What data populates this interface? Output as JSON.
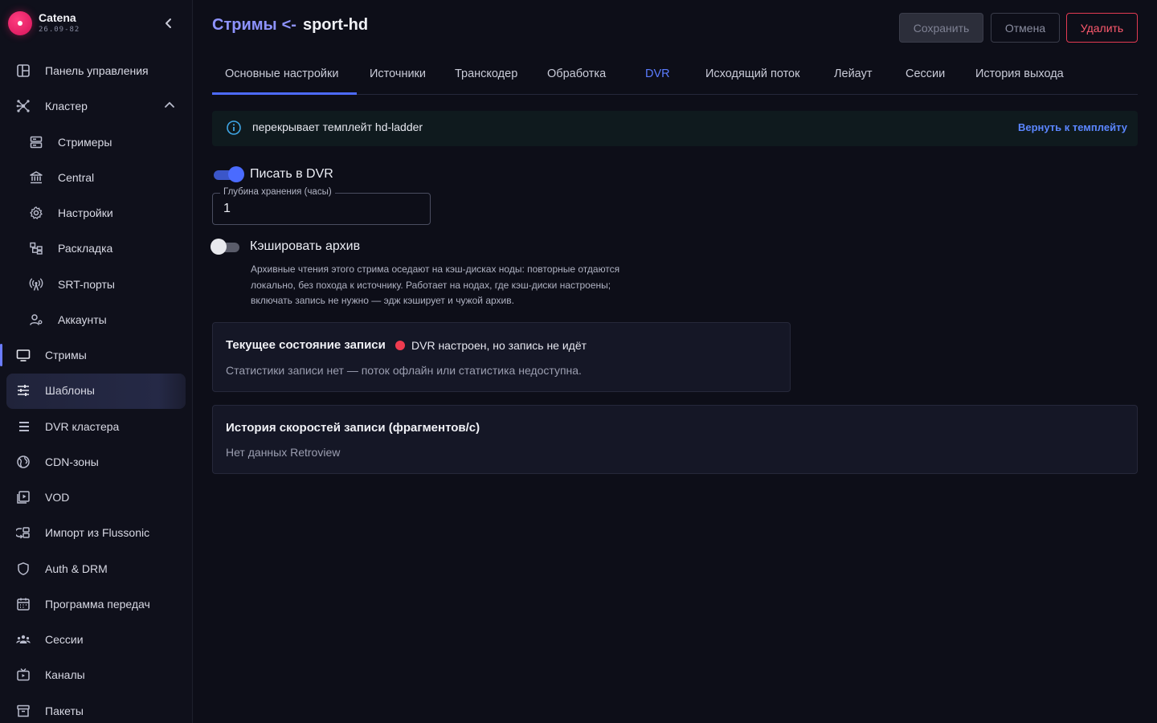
{
  "brand": {
    "name": "Catena",
    "version": "26.09-82"
  },
  "sidebar": {
    "items": [
      {
        "label": "Панель управления",
        "icon": "dashboard-icon"
      },
      {
        "label": "Кластер",
        "icon": "cluster-icon",
        "expanded": true
      },
      {
        "label": "Стримеры",
        "icon": "server-icon"
      },
      {
        "label": "Central",
        "icon": "bank-icon"
      },
      {
        "label": "Настройки",
        "icon": "gear-icon"
      },
      {
        "label": "Раскладка",
        "icon": "layout-icon"
      },
      {
        "label": "SRT-порты",
        "icon": "antenna-icon"
      },
      {
        "label": "Аккаунты",
        "icon": "accounts-icon"
      },
      {
        "label": "Стримы",
        "icon": "monitor-icon",
        "selected": true
      },
      {
        "label": "Шаблоны",
        "icon": "sliders-icon",
        "highlighted": true
      },
      {
        "label": "DVR кластера",
        "icon": "storage-icon"
      },
      {
        "label": "CDN-зоны",
        "icon": "globe-icon"
      },
      {
        "label": "VOD",
        "icon": "video-icon"
      },
      {
        "label": "Импорт из Flussonic",
        "icon": "import-icon"
      },
      {
        "label": "Auth & DRM",
        "icon": "shield-icon"
      },
      {
        "label": "Программа передач",
        "icon": "calendar-icon"
      },
      {
        "label": "Сессии",
        "icon": "people-icon"
      },
      {
        "label": "Каналы",
        "icon": "tv-icon"
      },
      {
        "label": "Пакеты",
        "icon": "archive-icon"
      }
    ]
  },
  "header": {
    "breadcrumb": "Стримы",
    "arrow": "<-",
    "title": "sport-hd",
    "save_label": "Сохранить",
    "cancel_label": "Отмена",
    "delete_label": "Удалить"
  },
  "tabs": [
    {
      "label": "Основные настройки",
      "active": true
    },
    {
      "label": "Источники"
    },
    {
      "label": "Транскодер"
    },
    {
      "label": "Обработка"
    },
    {
      "label": "DVR",
      "highlighted": true
    },
    {
      "label": "Исходящий поток"
    },
    {
      "label": "Лейаут"
    },
    {
      "label": "Сессии"
    },
    {
      "label": "История выхода"
    }
  ],
  "notice": {
    "text": "перекрывает темплейт hd-ladder",
    "action": "Вернуть к темплейту"
  },
  "dvr": {
    "write_label": "Писать в DVR",
    "write_enabled": true,
    "depth_label": "Глубина хранения (часы)",
    "depth_value": "1",
    "cache_label": "Кэшировать архив",
    "cache_enabled": false,
    "cache_help_1": "Архивные чтения этого стрима оседают на кэш-дисках ноды: повторные отдаются",
    "cache_help_2": "локально, без похода к источнику. Работает на нодах, где кэш-диски настроены;",
    "cache_help_3": "включать запись не нужно — эдж кэширует и чужой архив."
  },
  "status_card": {
    "title": "Текущее состояние записи",
    "status": "DVR настроен, но запись не идёт",
    "status_color": "#ef3b4f",
    "detail": "Статистики записи нет — поток офлайн или статистика недоступна."
  },
  "history_card": {
    "title": "История скоростей записи (фрагментов/с)",
    "empty": "Нет данных Retroview"
  },
  "colors": {
    "accent": "#4d6bff",
    "link": "#5b86ff",
    "danger": "#e23a52",
    "brand": "#e0185f"
  }
}
